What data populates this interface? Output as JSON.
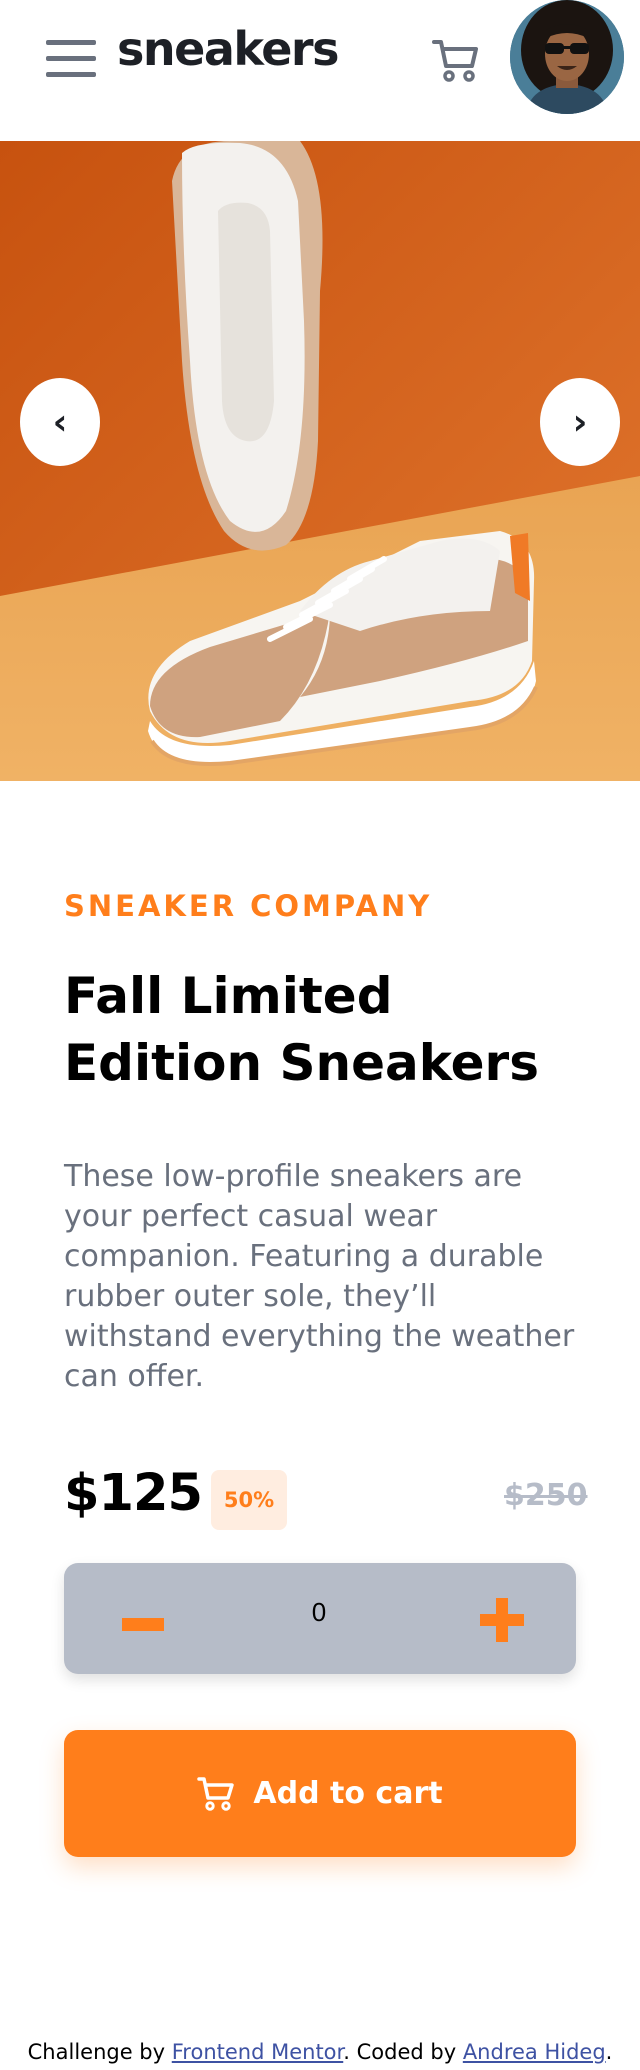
{
  "header": {
    "logo": "sneakers",
    "menu_icon": "hamburger-icon",
    "cart_icon": "cart-icon",
    "avatar_alt": "user-avatar"
  },
  "hero": {
    "prev_label": "‹",
    "next_label": "›",
    "prev_icon": "chevron-left-icon",
    "next_icon": "chevron-right-icon"
  },
  "product": {
    "company": "Sneaker Company",
    "title": "Fall Limited Edition Sneakers",
    "description": "These low-profile sneakers are your perfect casual wear companion. Featuring a durable rubber outer sole, they’ll withstand everything the weather can offer.",
    "price": "$125",
    "discount": "50%",
    "old_price": "$250"
  },
  "quantity": {
    "value": "0",
    "minus_icon": "minus-icon",
    "plus_icon": "plus-icon"
  },
  "add_to_cart": {
    "label": "Add to cart",
    "icon": "cart-icon"
  },
  "footer": {
    "prefix": "Challenge by ",
    "link1": "Frontend Mentor",
    "middle": ". Coded by ",
    "link2": "Andrea Hideg",
    "suffix": "."
  },
  "colors": {
    "accent": "#ff7e1b",
    "accent_pale": "#ffede0",
    "text_dark": "#1d2026",
    "text_gray": "#69707d",
    "stepper_bg": "#b6bcc8",
    "link": "#3e52a3"
  }
}
